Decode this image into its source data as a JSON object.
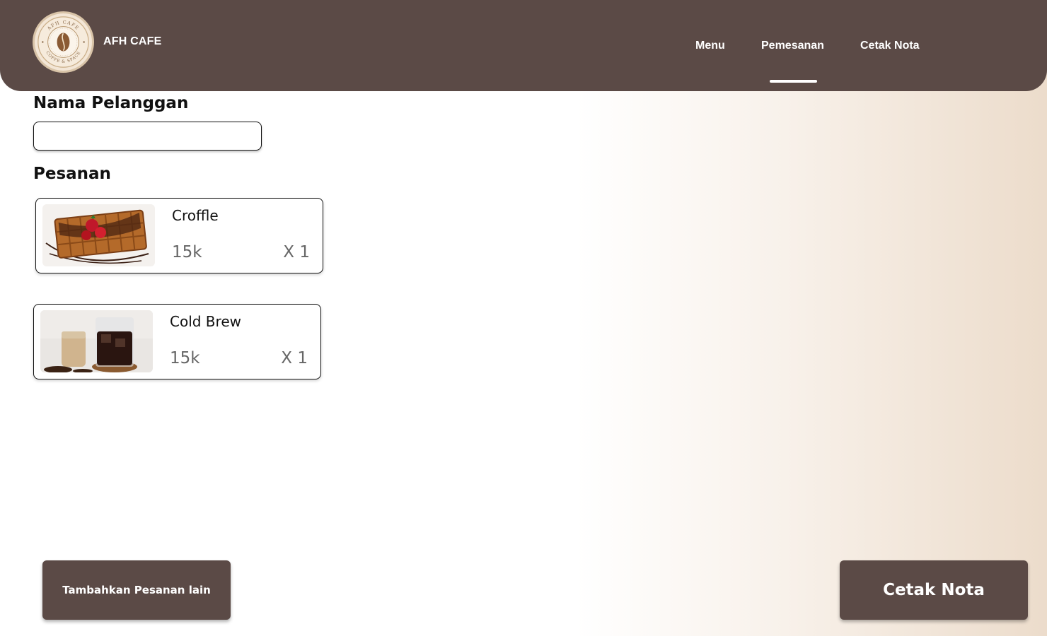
{
  "header": {
    "brand": "AFH CAFE",
    "logo": {
      "text_top": "AFH CAFE",
      "text_bottom": "COFFE & SPACE",
      "icon": "coffee-bean-icon"
    },
    "nav": [
      {
        "label": "Menu",
        "active": false
      },
      {
        "label": "Pemesanan",
        "active": true
      },
      {
        "label": "Cetak Nota",
        "active": false
      }
    ]
  },
  "form": {
    "customer_label": "Nama Pelanggan",
    "customer_value": "",
    "orders_label": "Pesanan"
  },
  "orders": [
    {
      "name": "Croffle",
      "price": "15k",
      "qty": "X 1",
      "image": "croffle-image"
    },
    {
      "name": "Cold Brew",
      "price": "15k",
      "qty": "X 1",
      "image": "cold-brew-image"
    }
  ],
  "actions": {
    "add_more_label": "Tambahkan Pesanan lain",
    "print_label": "Cetak Nota"
  },
  "colors": {
    "primary": "#5b4a46",
    "background_end": "#ecdccb"
  }
}
